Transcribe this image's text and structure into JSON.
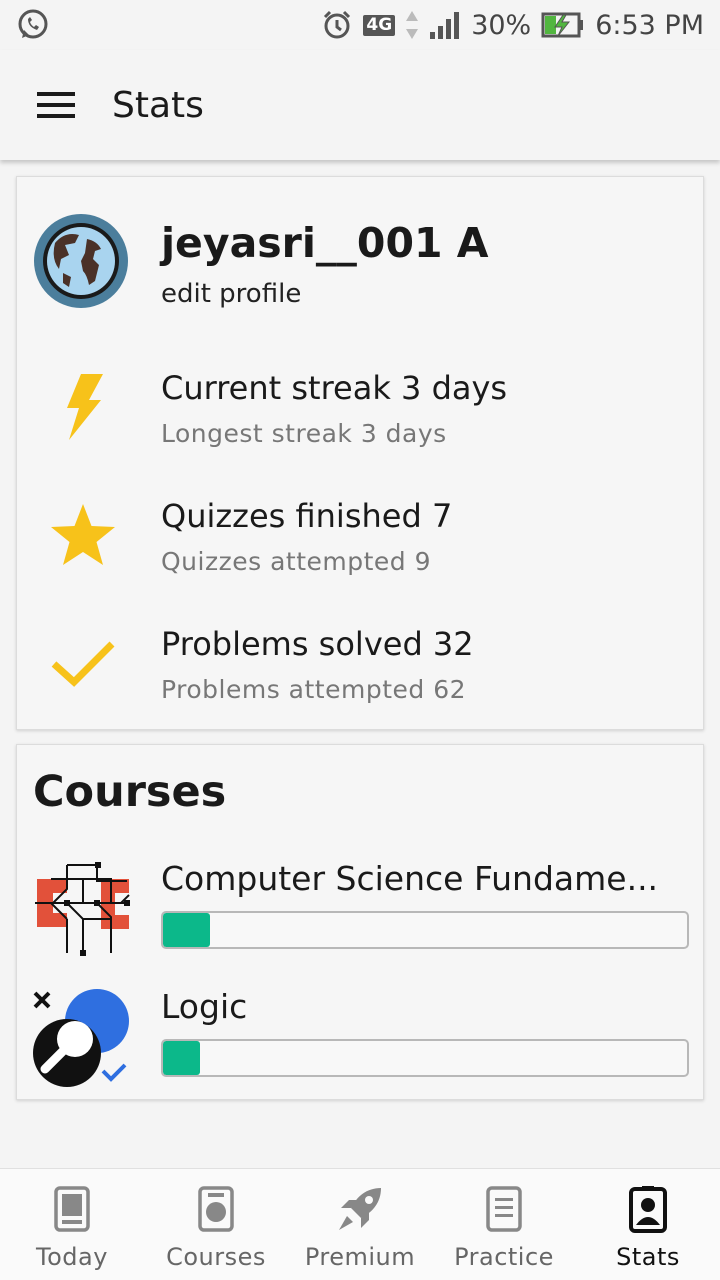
{
  "status_bar": {
    "network": "4G",
    "battery": "30%",
    "time": "6:53 PM",
    "icons": [
      "whatsapp-icon",
      "alarm-icon",
      "signal-icon",
      "battery-charging-icon"
    ]
  },
  "app_bar": {
    "title": "Stats",
    "menu_icon": "hamburger-menu-icon"
  },
  "profile": {
    "username": "jeyasri__001 A",
    "edit_label": "edit profile",
    "avatar_icon": "globe-avatar-icon"
  },
  "stats": [
    {
      "icon": "lightning-icon",
      "main": "Current streak 3 days",
      "sub": "Longest streak 3 days"
    },
    {
      "icon": "star-icon",
      "main": "Quizzes finished 7",
      "sub": "Quizzes attempted 9"
    },
    {
      "icon": "checkmark-icon",
      "main": "Problems solved 32",
      "sub": "Problems attempted 62"
    }
  ],
  "courses": {
    "title": "Courses",
    "items": [
      {
        "name": "Computer Science Fundame...",
        "progress": 0.09,
        "icon": "cs-fundamentals-icon"
      },
      {
        "name": "Logic",
        "progress": 0.07,
        "icon": "logic-icon"
      }
    ]
  },
  "bottom_nav": {
    "items": [
      {
        "label": "Today",
        "icon": "today-icon",
        "active": false
      },
      {
        "label": "Courses",
        "icon": "courses-icon",
        "active": false
      },
      {
        "label": "Premium",
        "icon": "rocket-icon",
        "active": false
      },
      {
        "label": "Practice",
        "icon": "practice-icon",
        "active": false
      },
      {
        "label": "Stats",
        "icon": "stats-profile-icon",
        "active": true
      }
    ]
  },
  "colors": {
    "accent_yellow": "#f7c21a",
    "progress_green": "#0cb88a",
    "background": "#f4f4f4"
  }
}
